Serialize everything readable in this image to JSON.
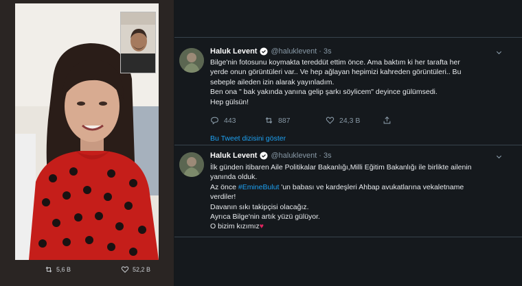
{
  "photo_actions": {
    "retweets": "5,6 B",
    "likes": "52,2 B"
  },
  "tweets": [
    {
      "name": "Haluk Levent",
      "handle": "@haluklevent",
      "dot": "·",
      "time": "3s",
      "lines": [
        "Bilge'nin fotosunu koymakta tereddüt ettim önce. Ama baktım ki her tarafta her",
        "yerde onun görüntüleri var.. Ve hep ağlayan hepimizi kahreden görüntüleri.. Bu",
        "sebeple aileden izin alarak yayınladım.",
        "Ben ona \" bak yakında yanına gelip şarkı söylicem\" deyince gülümsedi.",
        "Hep gülsün!"
      ],
      "replies": "443",
      "retweets": "887",
      "likes": "24,3 B",
      "thread_link": "Bu Tweet dizisini göster"
    },
    {
      "name": "Haluk Levent",
      "handle": "@haluklevent",
      "dot": "·",
      "time": "3s",
      "line1": "İlk günden itibaren Aile Politikalar Bakanlığı,Milli Eğitim Bakanlığı ile birlikte ailenin",
      "line2": "yanında olduk.",
      "line3_pre": "Az önce ",
      "line3_tag": "#EmineBulut",
      "line3_post": " 'un babası ve kardeşleri Ahbap avukatlarına vekaletname",
      "line4": "verdiler!",
      "line5": "Davanın sıkı takipçisi olacağız.",
      "line6": "Ayrıca Bilge'nin artık yüzü gülüyor.",
      "line7": "O bizim kızımız",
      "heart": "♥"
    }
  ],
  "colors": {
    "background": "#15191d",
    "link": "#1da1f2",
    "muted": "#8899a6",
    "heart": "#e0245e"
  }
}
